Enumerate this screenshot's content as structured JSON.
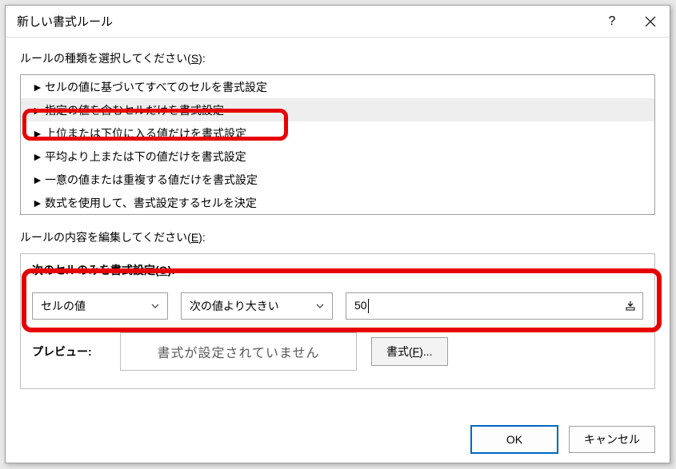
{
  "dialog": {
    "title": "新しい書式ルール"
  },
  "ruleType": {
    "label_pre": "ルールの種類を選択してください(",
    "label_key": "S",
    "label_post": "):",
    "items": [
      "セルの値に基づいてすべてのセルを書式設定",
      "指定の値を含むセルだけを書式設定",
      "上位または下位に入る値だけを書式設定",
      "平均より上または下の値だけを書式設定",
      "一意の値または重複する値だけを書式設定",
      "数式を使用して、書式設定するセルを決定"
    ],
    "selected_index": 1
  },
  "ruleEdit": {
    "label_pre": "ルールの内容を編集してください(",
    "label_key": "E",
    "label_post": "):",
    "subtitle_pre": "次のセルのみを書式設定(",
    "subtitle_key": "O",
    "subtitle_post": "):",
    "combo1": "セルの値",
    "combo2": "次の値より大きい",
    "value": "50"
  },
  "preview": {
    "label": "プレビュー:",
    "text": "書式が設定されていません",
    "format_btn_pre": "書式(",
    "format_btn_key": "F",
    "format_btn_post": ")..."
  },
  "footer": {
    "ok": "OK",
    "cancel": "キャンセル"
  }
}
